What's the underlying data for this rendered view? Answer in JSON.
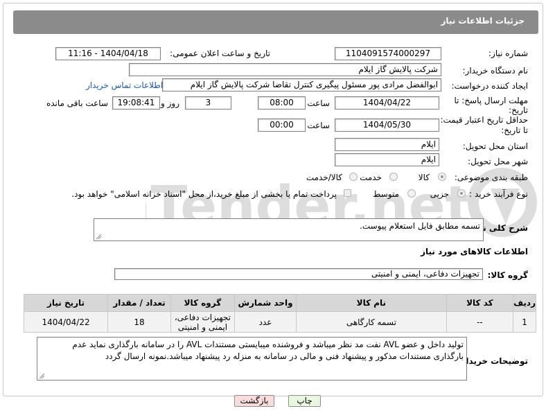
{
  "header": {
    "title": "جزئیات اطلاعات نیاز"
  },
  "need_number": {
    "label": "شماره نیاز:",
    "value": "1104091574000297"
  },
  "announce": {
    "label": "تاریخ و ساعت اعلان عمومی:",
    "value": "1404/04/18 - 11:16"
  },
  "buyer_org": {
    "label": "نام دستگاه خریدار:",
    "value": "شرکت پالایش گاز ایلام"
  },
  "creator": {
    "label": "ایجاد کننده درخواست:",
    "value": "ابوالفضل مرادی پور مسئول پیگیری کنترل تقاضا شرکت پالایش گاز ایلام",
    "contact_link": "اطلاعات تماس خریدار"
  },
  "deadline": {
    "label_line1": "مهلت ارسال پاسخ: تا",
    "label_line2": "تاریخ:",
    "date": "1404/04/22",
    "time_label": "ساعت",
    "time": "08:00",
    "days": "3",
    "days_label": "روز و",
    "remaining": "19:08:41",
    "remaining_label": "ساعت باقی مانده"
  },
  "validity": {
    "label_line1": "حداقل تاریخ اعتبار قیمت:",
    "label_line2": "تا تاریخ:",
    "date": "1404/05/30",
    "time_label": "ساعت",
    "time": "00:00"
  },
  "province": {
    "label": "استان محل تحویل:",
    "value": "ایلام"
  },
  "city": {
    "label": "شهر محل تحویل:",
    "value": "ایلام"
  },
  "category": {
    "label": "طبقه بندی موضوعی:",
    "options": [
      "کالا",
      "خدمت",
      "کالا/خدمت"
    ]
  },
  "process": {
    "label": "نوع فرآیند خرید :",
    "options": [
      "جزیی",
      "متوسط"
    ],
    "payment_note": "پرداخت تمام یا بخشی از مبلغ خرید،از محل \"اسناد خزانه اسلامی\" خواهد بود."
  },
  "description": {
    "label": "شرح کلی نیاز:",
    "value": "تسمه مطابق فایل استعلام پیوست."
  },
  "goods_section": {
    "title": "اطلاعات کالاهای مورد نیاز"
  },
  "goods_group": {
    "label": "گروه کالا:",
    "value": "تجهیزات دفاعی، ایمنی و امنیتی"
  },
  "table": {
    "headers": [
      "ردیف",
      "کد کالا",
      "نام کالا",
      "واحد شمارش",
      "گروه کالا",
      "تعداد / مقدار",
      "تاریخ نیاز"
    ],
    "rows": [
      {
        "row": "1",
        "code": "--",
        "name": "تسمه کارگاهی",
        "unit": "عدد",
        "group": "تجهیزات دفاعی، ایمنی و امنیتی",
        "qty": "18",
        "date": "1404/04/22"
      }
    ]
  },
  "buyer_notes": {
    "label": "توضیحات خریدار:",
    "value": "تولید داخل و عضو AVL نفت مد نظر میباشد و فروشنده میبایستی مستندات AVL را در سامانه بارگذاری نماید عدم بارگذاری مستندات مذکور و پیشنهاد فنی و مالی در سامانه به منزله رد پیشنهاد میباشد.نمونه ارسال گردد"
  },
  "buttons": {
    "print": "چاپ",
    "back": "بازگشت"
  },
  "watermark": {
    "text": "AriaTender.net"
  },
  "colors": {
    "header_bg": "#8b8b8b",
    "link": "#1a56c4",
    "back_btn_bg": "#fbdcdc",
    "print_btn_bg": "#e9f7e1"
  }
}
